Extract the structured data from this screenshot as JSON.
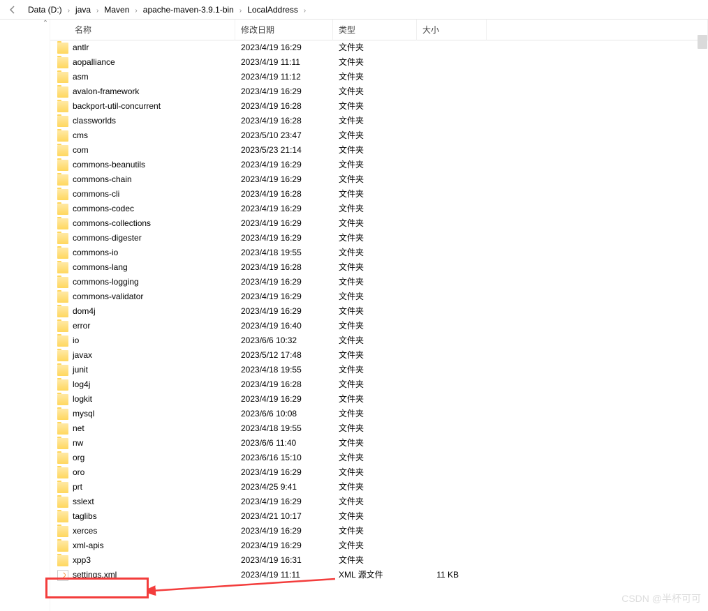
{
  "breadcrumb": {
    "items": [
      {
        "label": "Data (D:)"
      },
      {
        "label": "java"
      },
      {
        "label": "Maven"
      },
      {
        "label": "apache-maven-3.9.1-bin"
      },
      {
        "label": "LocalAddress"
      }
    ]
  },
  "columns": {
    "name": "名称",
    "modified": "修改日期",
    "type": "类型",
    "size": "大小"
  },
  "type_labels": {
    "folder": "文件夹",
    "xml": "XML 源文件"
  },
  "files": [
    {
      "name": "antlr",
      "modified": "2023/4/19 16:29",
      "type": "folder",
      "size": ""
    },
    {
      "name": "aopalliance",
      "modified": "2023/4/19 11:11",
      "type": "folder",
      "size": ""
    },
    {
      "name": "asm",
      "modified": "2023/4/19 11:12",
      "type": "folder",
      "size": ""
    },
    {
      "name": "avalon-framework",
      "modified": "2023/4/19 16:29",
      "type": "folder",
      "size": ""
    },
    {
      "name": "backport-util-concurrent",
      "modified": "2023/4/19 16:28",
      "type": "folder",
      "size": ""
    },
    {
      "name": "classworlds",
      "modified": "2023/4/19 16:28",
      "type": "folder",
      "size": ""
    },
    {
      "name": "cms",
      "modified": "2023/5/10 23:47",
      "type": "folder",
      "size": ""
    },
    {
      "name": "com",
      "modified": "2023/5/23 21:14",
      "type": "folder",
      "size": ""
    },
    {
      "name": "commons-beanutils",
      "modified": "2023/4/19 16:29",
      "type": "folder",
      "size": ""
    },
    {
      "name": "commons-chain",
      "modified": "2023/4/19 16:29",
      "type": "folder",
      "size": ""
    },
    {
      "name": "commons-cli",
      "modified": "2023/4/19 16:28",
      "type": "folder",
      "size": ""
    },
    {
      "name": "commons-codec",
      "modified": "2023/4/19 16:29",
      "type": "folder",
      "size": ""
    },
    {
      "name": "commons-collections",
      "modified": "2023/4/19 16:29",
      "type": "folder",
      "size": ""
    },
    {
      "name": "commons-digester",
      "modified": "2023/4/19 16:29",
      "type": "folder",
      "size": ""
    },
    {
      "name": "commons-io",
      "modified": "2023/4/18 19:55",
      "type": "folder",
      "size": ""
    },
    {
      "name": "commons-lang",
      "modified": "2023/4/19 16:28",
      "type": "folder",
      "size": ""
    },
    {
      "name": "commons-logging",
      "modified": "2023/4/19 16:29",
      "type": "folder",
      "size": ""
    },
    {
      "name": "commons-validator",
      "modified": "2023/4/19 16:29",
      "type": "folder",
      "size": ""
    },
    {
      "name": "dom4j",
      "modified": "2023/4/19 16:29",
      "type": "folder",
      "size": ""
    },
    {
      "name": "error",
      "modified": "2023/4/19 16:40",
      "type": "folder",
      "size": ""
    },
    {
      "name": "io",
      "modified": "2023/6/6 10:32",
      "type": "folder",
      "size": ""
    },
    {
      "name": "javax",
      "modified": "2023/5/12 17:48",
      "type": "folder",
      "size": ""
    },
    {
      "name": "junit",
      "modified": "2023/4/18 19:55",
      "type": "folder",
      "size": ""
    },
    {
      "name": "log4j",
      "modified": "2023/4/19 16:28",
      "type": "folder",
      "size": ""
    },
    {
      "name": "logkit",
      "modified": "2023/4/19 16:29",
      "type": "folder",
      "size": ""
    },
    {
      "name": "mysql",
      "modified": "2023/6/6 10:08",
      "type": "folder",
      "size": ""
    },
    {
      "name": "net",
      "modified": "2023/4/18 19:55",
      "type": "folder",
      "size": ""
    },
    {
      "name": "nw",
      "modified": "2023/6/6 11:40",
      "type": "folder",
      "size": ""
    },
    {
      "name": "org",
      "modified": "2023/6/16 15:10",
      "type": "folder",
      "size": ""
    },
    {
      "name": "oro",
      "modified": "2023/4/19 16:29",
      "type": "folder",
      "size": ""
    },
    {
      "name": "prt",
      "modified": "2023/4/25 9:41",
      "type": "folder",
      "size": ""
    },
    {
      "name": "sslext",
      "modified": "2023/4/19 16:29",
      "type": "folder",
      "size": ""
    },
    {
      "name": "taglibs",
      "modified": "2023/4/21 10:17",
      "type": "folder",
      "size": ""
    },
    {
      "name": "xerces",
      "modified": "2023/4/19 16:29",
      "type": "folder",
      "size": ""
    },
    {
      "name": "xml-apis",
      "modified": "2023/4/19 16:29",
      "type": "folder",
      "size": ""
    },
    {
      "name": "xpp3",
      "modified": "2023/4/19 16:31",
      "type": "folder",
      "size": ""
    },
    {
      "name": "settings.xml",
      "modified": "2023/4/19 11:11",
      "type": "xml",
      "size": "11 KB"
    }
  ],
  "watermark": "CSDN @半杯可可"
}
